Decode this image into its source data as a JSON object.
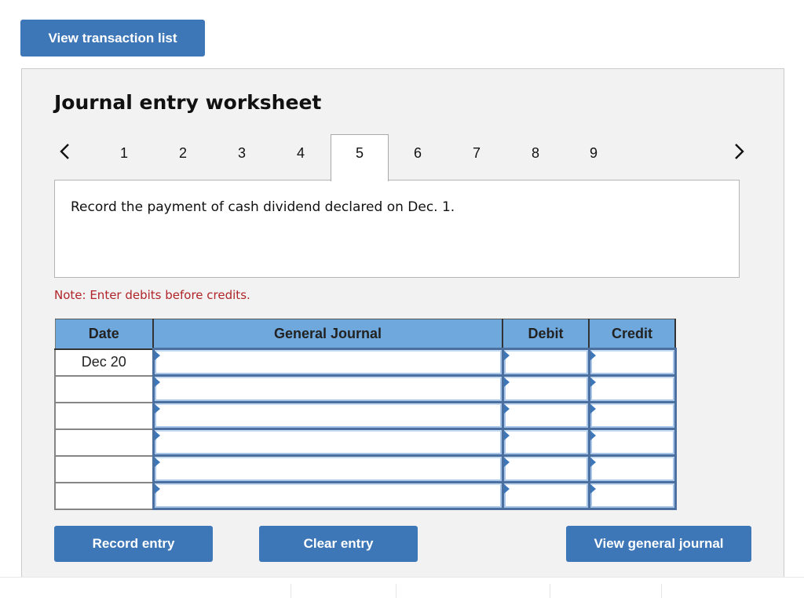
{
  "top_button": {
    "label": "View transaction list"
  },
  "worksheet": {
    "title": "Journal entry worksheet",
    "prev_icon": "chevron-left-icon",
    "next_icon": "chevron-right-icon",
    "tabs": [
      {
        "label": "1"
      },
      {
        "label": "2"
      },
      {
        "label": "3"
      },
      {
        "label": "4"
      },
      {
        "label": "5",
        "active": true
      },
      {
        "label": "6"
      },
      {
        "label": "7"
      },
      {
        "label": "8"
      },
      {
        "label": "9"
      }
    ],
    "active_tab": "5",
    "question": "Record the payment of cash dividend declared on Dec. 1.",
    "note": "Note: Enter debits before credits."
  },
  "journal": {
    "headers": {
      "date": "Date",
      "general_journal": "General Journal",
      "debit": "Debit",
      "credit": "Credit"
    },
    "rows": [
      {
        "date": "Dec 20",
        "account": "",
        "debit": "",
        "credit": ""
      },
      {
        "date": "",
        "account": "",
        "debit": "",
        "credit": ""
      },
      {
        "date": "",
        "account": "",
        "debit": "",
        "credit": ""
      },
      {
        "date": "",
        "account": "",
        "debit": "",
        "credit": ""
      },
      {
        "date": "",
        "account": "",
        "debit": "",
        "credit": ""
      },
      {
        "date": "",
        "account": "",
        "debit": "",
        "credit": ""
      }
    ]
  },
  "actions": {
    "record_entry": "Record entry",
    "clear_entry": "Clear entry",
    "view_general_journal": "View general journal"
  },
  "colors": {
    "button_blue": "#3e77b8",
    "header_blue": "#6fa8dc",
    "note_red": "#b0242a",
    "panel_bg": "#f2f2f2"
  }
}
